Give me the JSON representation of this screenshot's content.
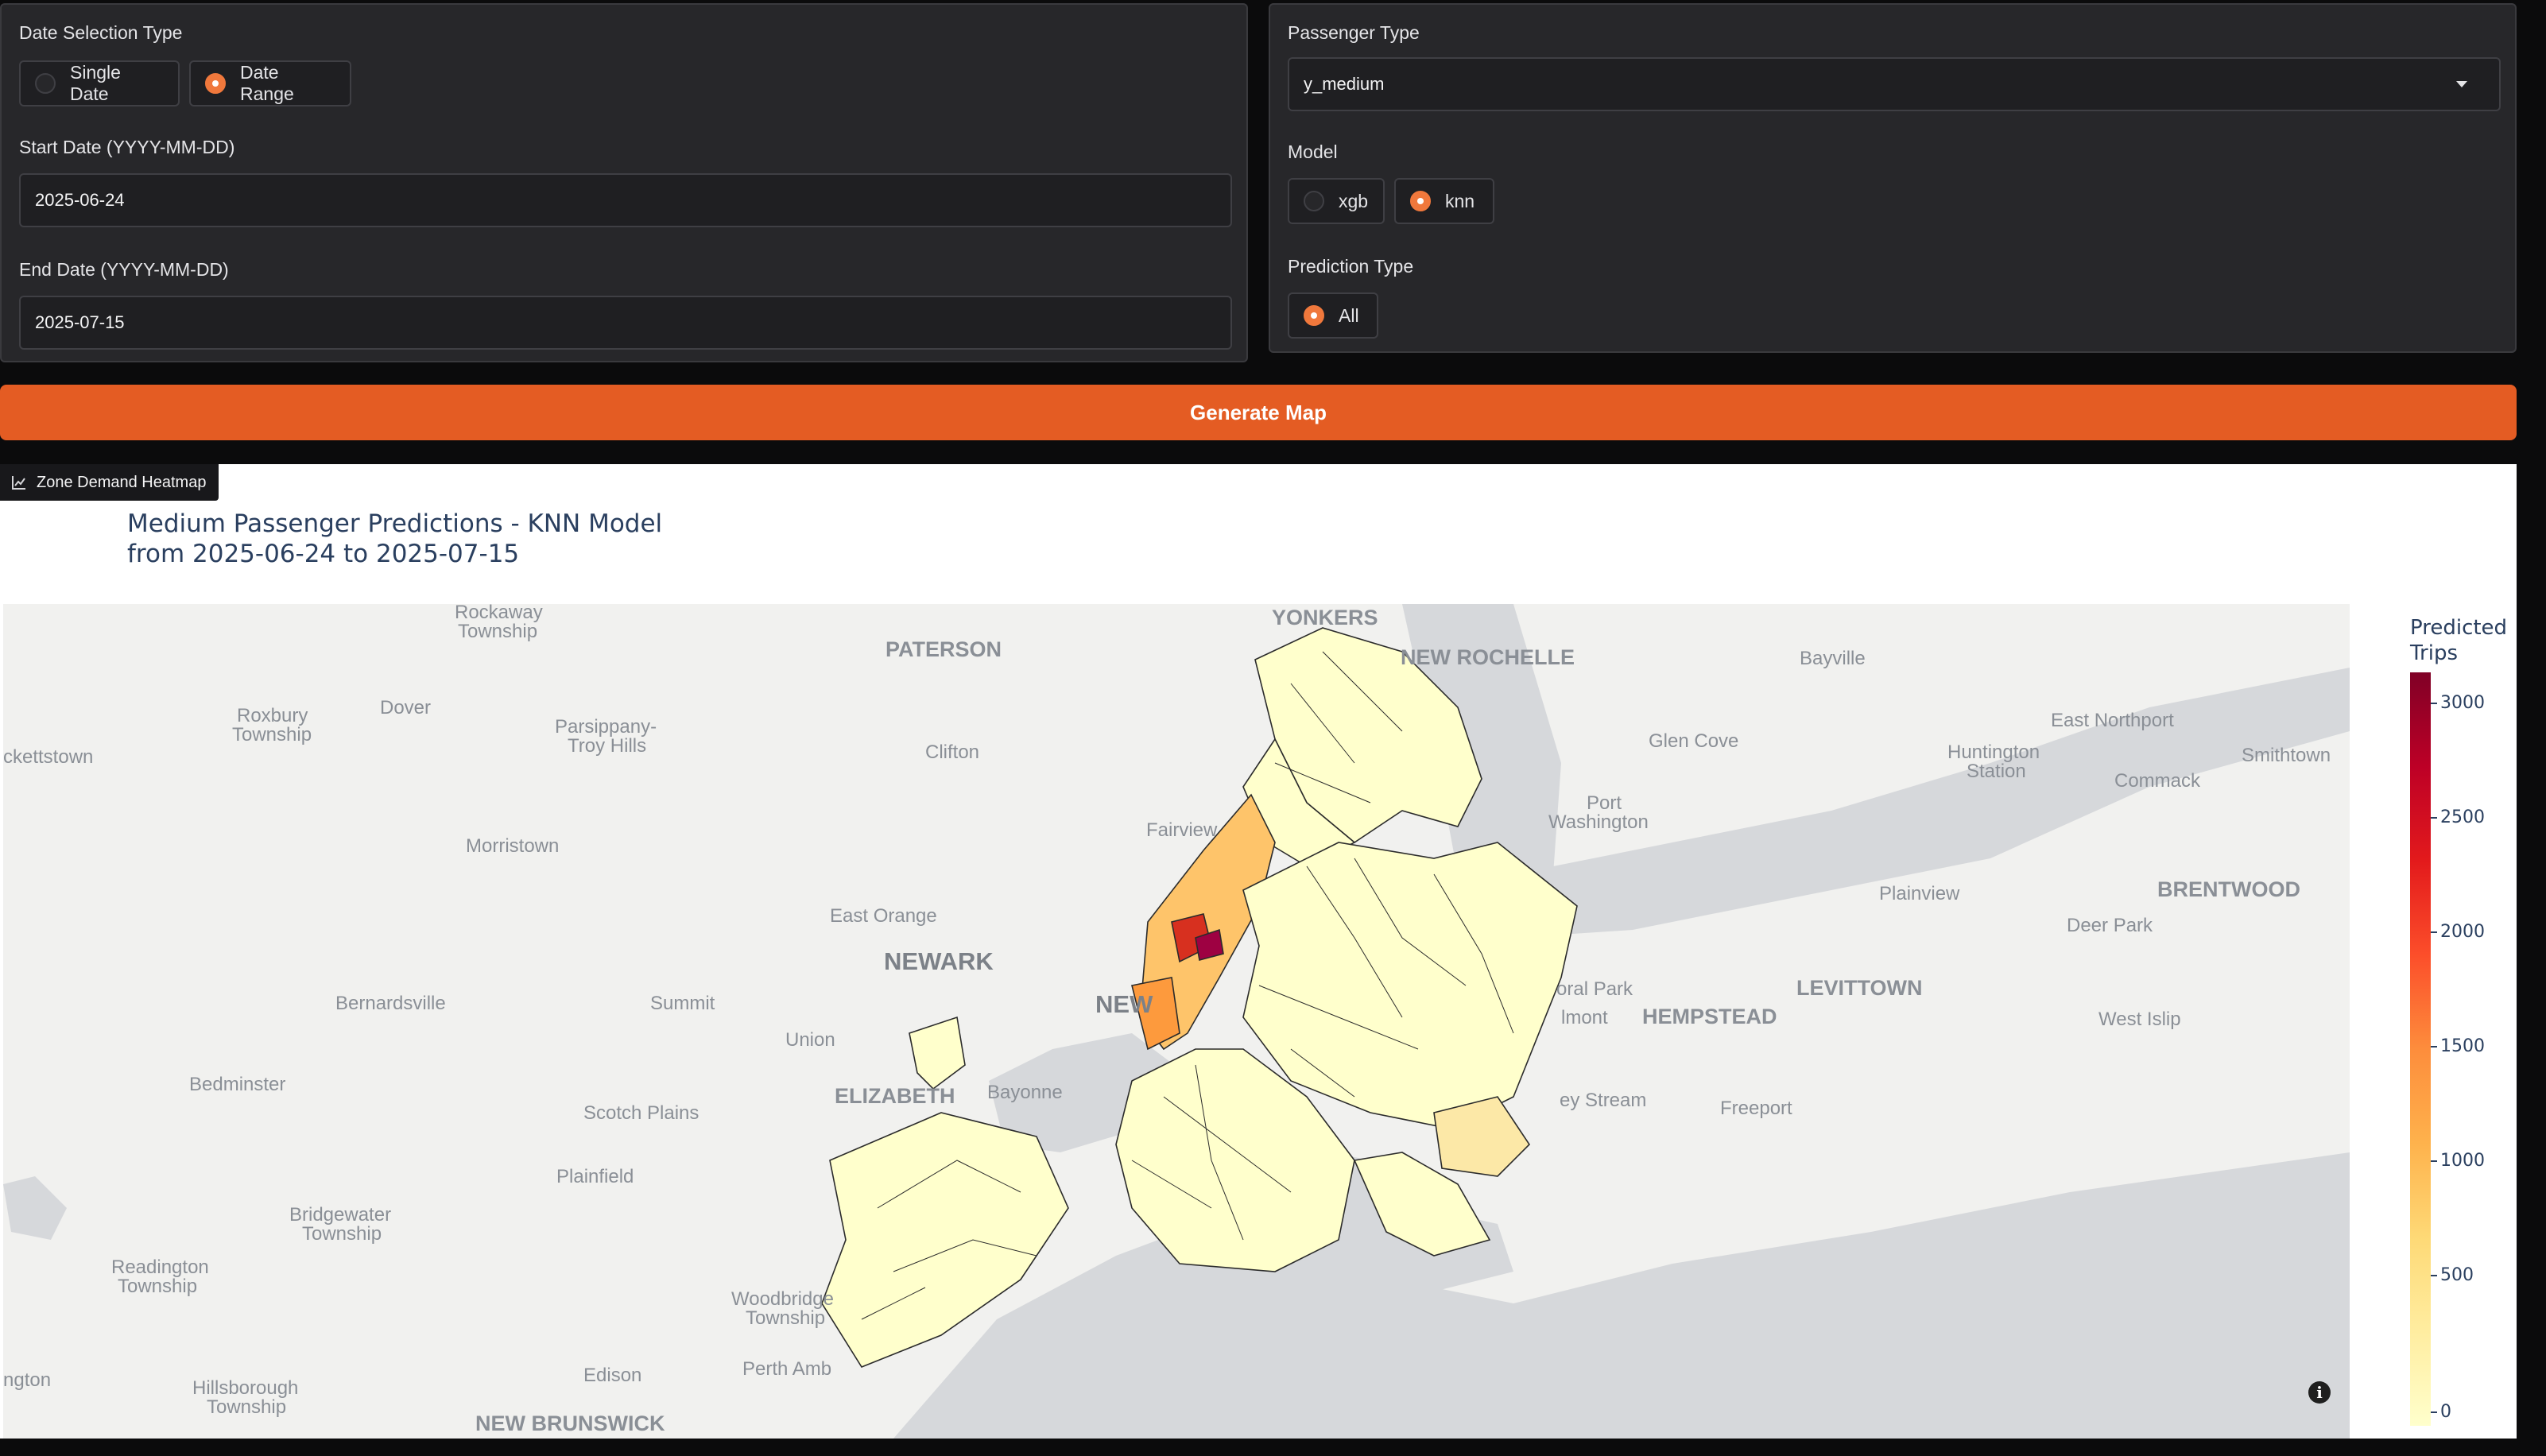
{
  "date_panel": {
    "date_type_label": "Date Selection Type",
    "date_type_options": [
      "Single Date",
      "Date Range"
    ],
    "date_type_selected": "Date Range",
    "start_label": "Start Date (YYYY-MM-DD)",
    "start_value": "2025-06-24",
    "end_label": "End Date (YYYY-MM-DD)",
    "end_value": "2025-07-15"
  },
  "options_panel": {
    "passenger_label": "Passenger Type",
    "passenger_value": "y_medium",
    "model_label": "Model",
    "model_options": [
      "xgb",
      "knn"
    ],
    "model_selected": "knn",
    "prediction_label": "Prediction Type",
    "prediction_options": [
      "All"
    ],
    "prediction_selected": "All"
  },
  "generate_button": "Generate Map",
  "plot": {
    "tab_label": "Zone Demand Heatmap",
    "title_line1": "Medium Passenger Predictions - KNN Model",
    "title_line2": "from 2025-06-24 to 2025-07-15",
    "colorbar_title_line1": "Predicted",
    "colorbar_title_line2": "Trips",
    "colorbar_ticks": [
      "3000",
      "2500",
      "2000",
      "1500",
      "1000",
      "500",
      "0"
    ],
    "colorscale": [
      "#ffffcc",
      "#ffeda0",
      "#fed976",
      "#feb24c",
      "#fd8d3c",
      "#fc4e2a",
      "#e31a1c",
      "#bd0026",
      "#800026"
    ],
    "place_labels": {
      "rockaway": "Rockaway",
      "rockaway2": "Township",
      "yonkers": "YONKERS",
      "paterson": "PATERSON",
      "newrochelle": "NEW ROCHELLE",
      "bayville": "Bayville",
      "roxbury": "Roxbury",
      "roxbury2": "Township",
      "dover": "Dover",
      "parsippany": "Parsippany-",
      "parsippany2": "Troy Hills",
      "clifton": "Clifton",
      "glencove": "Glen Cove",
      "eastnorthport": "East Northport",
      "huntington": "Huntington",
      "huntington2": "Station",
      "smithtown": "Smithtown",
      "hackettstown": "ckettstown",
      "commack": "Commack",
      "portwash": "Port",
      "portwash2": "Washington",
      "fairview": "Fairview",
      "morristown": "Morristown",
      "plainview": "Plainview",
      "brentwood": "BRENTWOOD",
      "eastorange": "East Orange",
      "deerpark": "Deer Park",
      "newark": "NEWARK",
      "levittown": "LEVITTOWN",
      "bernardsville": "Bernardsville",
      "summit": "Summit",
      "new": "NEW",
      "oralpark": "oral Park",
      "elmont": "lmont",
      "hempstead": "HEMPSTEAD",
      "westislip": "West Islip",
      "union": "Union",
      "bedminster": "Bedminster",
      "elizabeth": "ELIZABETH",
      "bayonne": "Bayonne",
      "valleystream": "ey Stream",
      "freeport": "Freeport",
      "scotchplains": "Scotch Plains",
      "plainfield": "Plainfield",
      "bridgewater": "Bridgewater",
      "bridgewater2": "Township",
      "readington": "Readington",
      "readington2": "Township",
      "woodbridge": "Woodbridge",
      "woodbridge2": "Township",
      "edison": "Edison",
      "perthamboy": "Perth Amb",
      "hillsborough": "Hillsborough",
      "hillsborough2": "Township",
      "newbrunswick": "NEW BRUNSWICK",
      "ngton": "ngton"
    }
  }
}
